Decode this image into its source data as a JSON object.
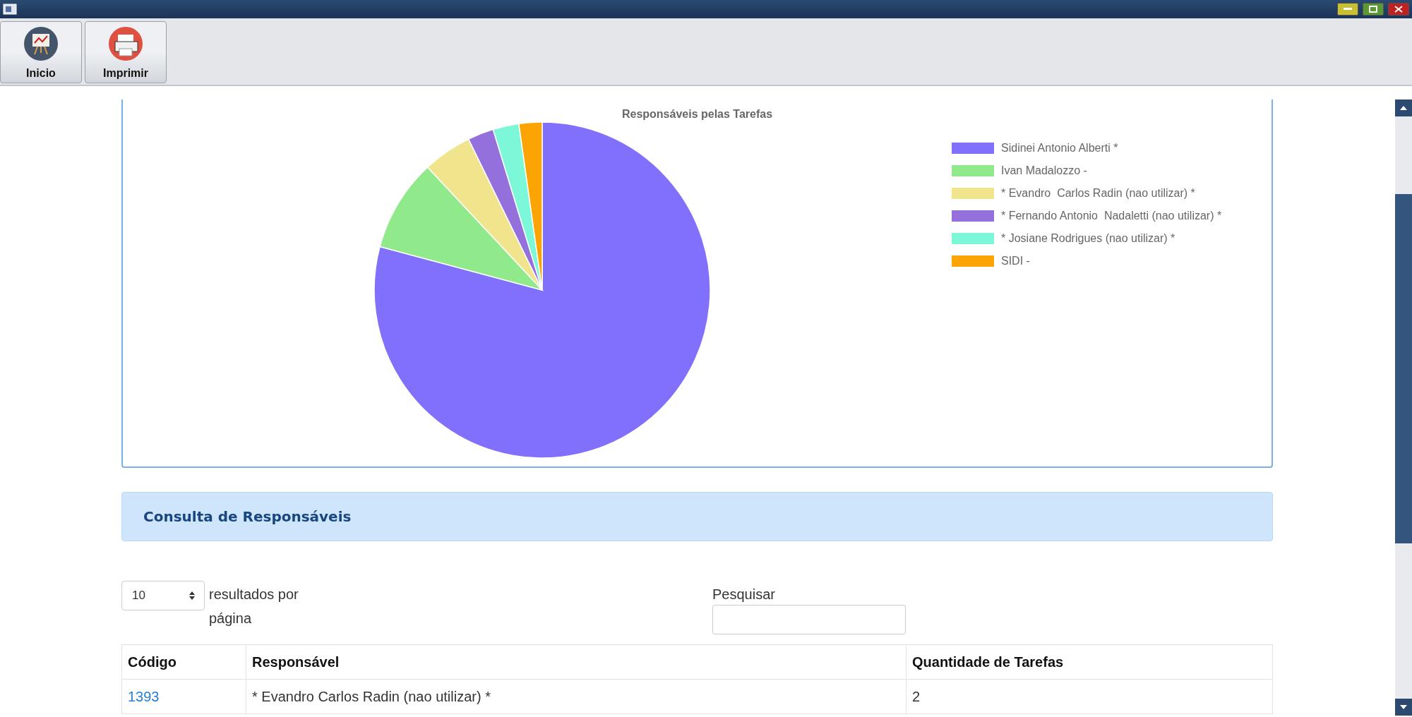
{
  "toolbar": {
    "buttons": [
      {
        "kind": "home",
        "label": "Inicio"
      },
      {
        "kind": "print",
        "label": "Imprimir"
      }
    ]
  },
  "chart": {
    "title": "Responsáveis pelas Tarefas",
    "legend": [
      {
        "label": "Sidinei Antonio Alberti *",
        "color": "#8070fc"
      },
      {
        "label": "Ivan Madalozzo -",
        "color": "#90ea8c"
      },
      {
        "label": "* Evandro  Carlos Radin (nao utilizar) *",
        "color": "#f0e48c"
      },
      {
        "label": "* Fernando Antonio  Nadaletti (nao utilizar) *",
        "color": "#9370dc"
      },
      {
        "label": "* Josiane Rodrigues (nao utilizar) *",
        "color": "#7cf8d8"
      },
      {
        "label": "SIDI -",
        "color": "#fca404"
      }
    ]
  },
  "panel": {
    "title": "Consulta de Responsáveis"
  },
  "table_controls": {
    "page_size": "10",
    "page_size_label": "resultados por página",
    "search_label": "Pesquisar"
  },
  "table": {
    "columns": [
      "Código",
      "Responsável",
      "Quantidade de Tarefas"
    ],
    "rows": [
      {
        "cells": [
          "1393",
          "* Evandro Carlos Radin (nao utilizar) *",
          "2"
        ]
      }
    ]
  }
}
